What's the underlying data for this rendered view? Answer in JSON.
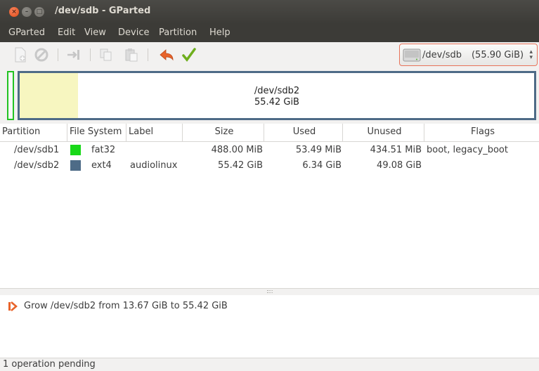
{
  "window": {
    "title": "/dev/sdb - GParted",
    "controls": {
      "close": "×",
      "minimize": "–",
      "maximize": "□"
    }
  },
  "menu": [
    "GParted",
    "Edit",
    "View",
    "Device",
    "Partition",
    "Help"
  ],
  "toolbar": {
    "icons": [
      "new-partition-icon",
      "delete-icon",
      "resize-move-icon",
      "copy-icon",
      "paste-icon",
      "undo-icon",
      "apply-icon"
    ],
    "device": {
      "name": "/dev/sdb",
      "size": "(55.90 GiB)"
    }
  },
  "disk_map": {
    "selected_name": "/dev/sdb2",
    "selected_size": "55.42 GiB",
    "used_fraction": 0.114,
    "colors": {
      "fat32": "#18d818",
      "ext4": "#4e6b87",
      "used": "#f7f6c0"
    }
  },
  "table": {
    "headers": {
      "partition": "Partition",
      "filesystem": "File System",
      "label": "Label",
      "size": "Size",
      "used": "Used",
      "unused": "Unused",
      "flags": "Flags"
    },
    "rows": [
      {
        "partition": "/dev/sdb1",
        "fs_color": "#18d818",
        "filesystem": "fat32",
        "label": "",
        "size": "488.00 MiB",
        "used": "53.49 MiB",
        "unused": "434.51 MiB",
        "flags": "boot, legacy_boot"
      },
      {
        "partition": "/dev/sdb2",
        "fs_color": "#4e6b87",
        "filesystem": "ext4",
        "label": "audiolinux",
        "size": "55.42 GiB",
        "used": "6.34 GiB",
        "unused": "49.08 GiB",
        "flags": ""
      }
    ]
  },
  "operations": [
    {
      "icon": "grow-icon",
      "text": "Grow /dev/sdb2 from 13.67 GiB to 55.42 GiB"
    }
  ],
  "status": "1 operation pending"
}
